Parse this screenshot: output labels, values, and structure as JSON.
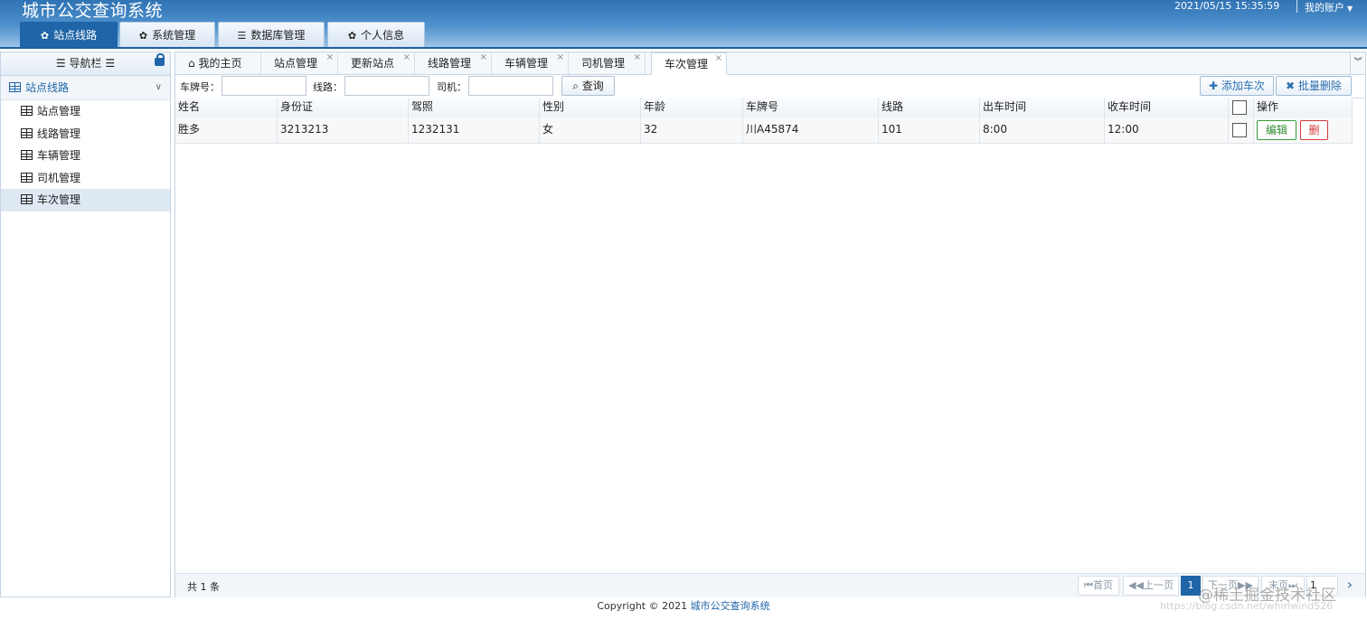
{
  "app": {
    "title": "城市公交查询系统",
    "datetime": "2021/05/15 15:35:59",
    "account_label": "我的账户"
  },
  "main_tabs": [
    {
      "label": "站点线路",
      "icon": "gear-icon",
      "active": true
    },
    {
      "label": "系统管理",
      "icon": "gear-icon",
      "active": false
    },
    {
      "label": "数据库管理",
      "icon": "database-icon",
      "active": false
    },
    {
      "label": "个人信息",
      "icon": "gear-icon",
      "active": false
    }
  ],
  "sidebar": {
    "header": "导航栏",
    "group_label": "站点线路",
    "items": [
      {
        "label": "站点管理"
      },
      {
        "label": "线路管理"
      },
      {
        "label": "车辆管理"
      },
      {
        "label": "司机管理"
      },
      {
        "label": "车次管理",
        "active": true
      }
    ]
  },
  "content_tabs": [
    {
      "label": "我的主页",
      "closable": false
    },
    {
      "label": "站点管理",
      "closable": true
    },
    {
      "label": "更新站点",
      "closable": true
    },
    {
      "label": "线路管理",
      "closable": true
    },
    {
      "label": "车辆管理",
      "closable": true
    },
    {
      "label": "司机管理",
      "closable": true
    },
    {
      "label": "车次管理",
      "closable": true,
      "active": true
    }
  ],
  "search": {
    "plate_label": "车牌号：",
    "plate_value": "",
    "route_label": "线路：",
    "route_value": "",
    "driver_label": "司机：",
    "driver_value": "",
    "query_button": "查询",
    "add_button": "添加车次",
    "batch_delete_button": "批量删除"
  },
  "table": {
    "columns": [
      "姓名",
      "身份证",
      "驾照",
      "性别",
      "年龄",
      "车牌号",
      "线路",
      "出车时间",
      "收车时间",
      "",
      "操作"
    ],
    "rows": [
      {
        "name": "胜多",
        "id_card": "3213213",
        "license": "1232131",
        "gender": "女",
        "age": "32",
        "plate": "川A45874",
        "route": "101",
        "depart": "8:00",
        "return": "12:00",
        "checked": false
      }
    ],
    "edit_label": "编辑",
    "delete_label": "删"
  },
  "pagination": {
    "total_text": "共 1 条",
    "first": "首页",
    "prev": "上一页",
    "current_page": "1",
    "next": "下一页",
    "last": "末页",
    "page_input": "1"
  },
  "footer": {
    "copyright": "Copyright © 2021",
    "link": "城市公交查询系统"
  },
  "watermark": {
    "main": "@稀土掘金技术社区",
    "url": "https://blog.csdn.net/whirlwind526"
  }
}
